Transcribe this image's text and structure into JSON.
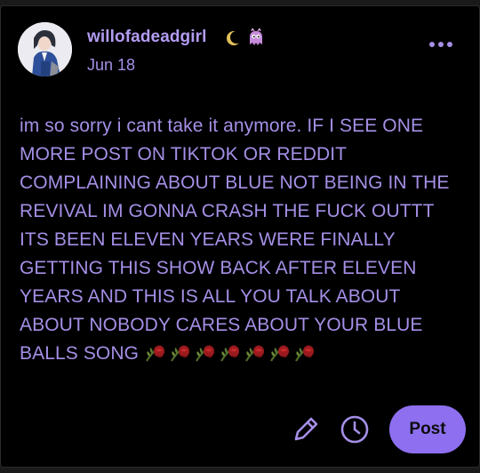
{
  "post": {
    "username": "willofadeadgirl",
    "date": "Jun 18",
    "badges": [
      "crescent-moon-badge",
      "monster-badge"
    ],
    "body": "im so sorry i cant take it anymore. IF I SEE ONE MORE POST ON TIKTOK OR REDDIT COMPLAINING ABOUT BLUE NOT BEING IN THE REVIVAL IM GONNA CRASH THE FUCK OUTTT ITS BEEN ELEVEN YEARS WERE FINALLY GETTING THIS SHOW BACK AFTER ELEVEN YEARS AND THIS IS ALL YOU TALK ABOUT ABOUT NOBODY CARES ABOUT YOUR BLUE BALLS SONG",
    "emoji": "wilted-rose",
    "emoji_count": 7
  },
  "actions": {
    "edit_icon": "pencil-icon",
    "schedule_icon": "clock-icon",
    "post_label": "Post"
  },
  "colors": {
    "accent": "#a58fe6",
    "button": "#8d6ff0",
    "background": "#000000"
  }
}
